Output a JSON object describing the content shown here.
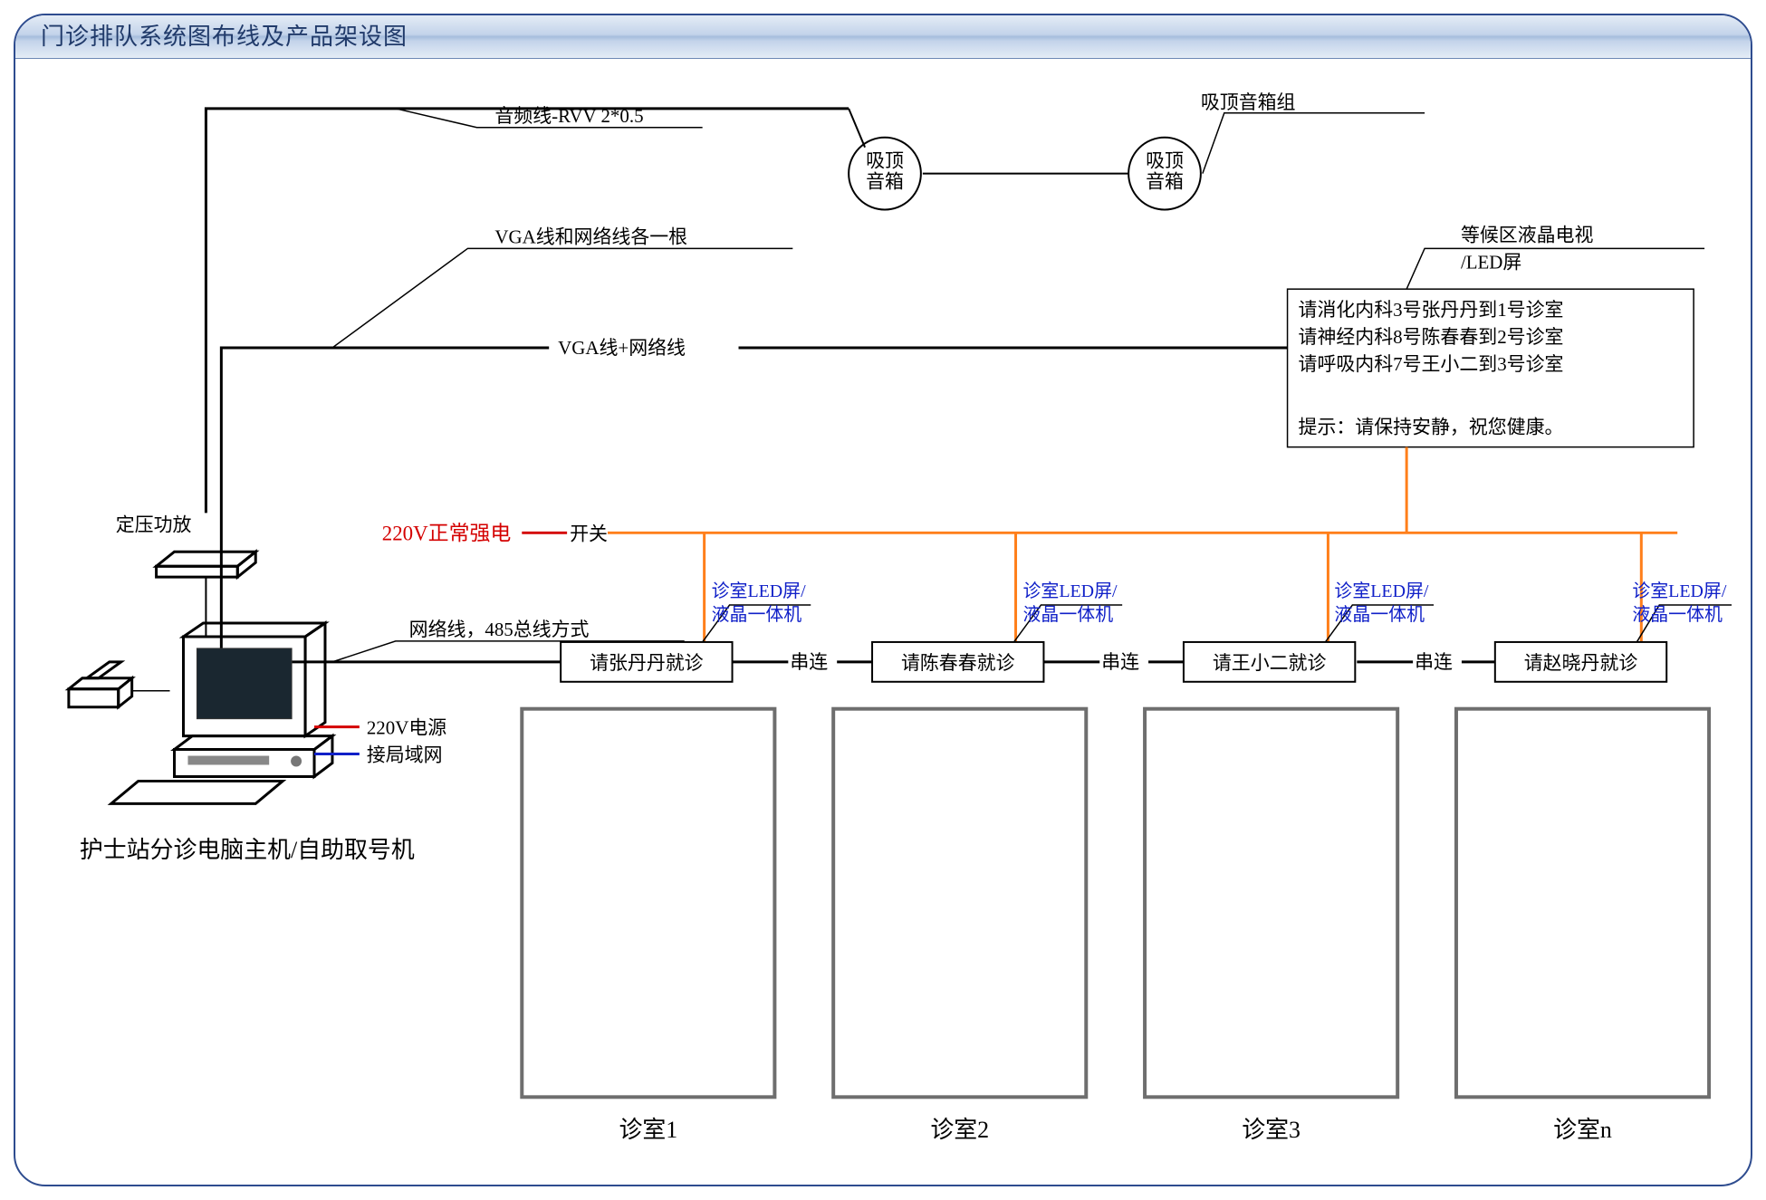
{
  "title": "门诊排队系统图布线及产品架设图",
  "labels": {
    "audio_cable": "音频线-RVV 2*0.5",
    "speaker": "吸顶\n音箱",
    "speaker_group": "吸顶音箱组",
    "vga_net_each": "VGA线和网络线各一根",
    "vga_net": "VGA线+网络线",
    "waiting_tv": "等候区液晶电视",
    "waiting_led": "/LED屏",
    "tv_line1": "请消化内科3号张丹丹到1号诊室",
    "tv_line2": "请神经内科8号陈春春到2号诊室",
    "tv_line3": "请呼吸内科7号王小二到3号诊室",
    "tv_tip": "提示：请保持安静，祝您健康。",
    "amp": "定压功放",
    "power_label": "220V正常强电",
    "switch": "开关",
    "rs485": "网络线，485总线方式",
    "led_screen": "诊室LED屏/",
    "lcd_aio": "液晶一体机",
    "serial": "串连",
    "p220": "220V电源",
    "lan": "接局域网",
    "host": "护士站分诊电脑主机/自助取号机"
  },
  "rooms": [
    {
      "name": "诊室1",
      "patient": "请张丹丹就诊"
    },
    {
      "name": "诊室2",
      "patient": "请陈春春就诊"
    },
    {
      "name": "诊室3",
      "patient": "请王小二就诊"
    },
    {
      "name": "诊室n",
      "patient": "请赵晓丹就诊"
    }
  ]
}
